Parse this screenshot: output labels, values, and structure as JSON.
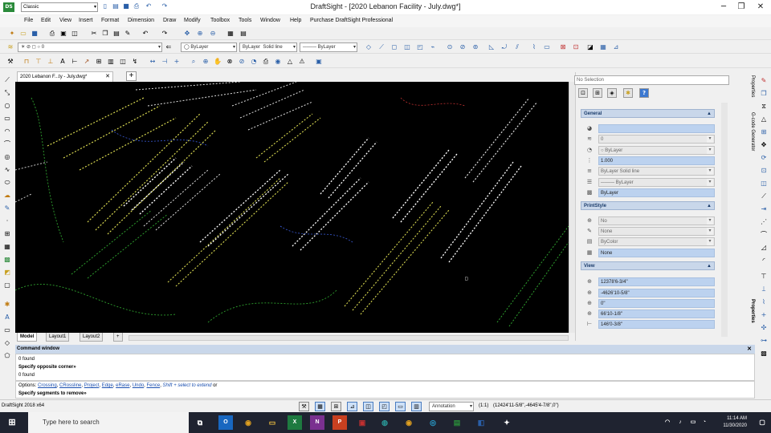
{
  "titlebar": {
    "workspace": "Classic",
    "title": "DraftSight - [2020 Lebanon Facility - July.dwg*]",
    "minimize": "─",
    "restore": "❐",
    "close": "✕"
  },
  "menubar": {
    "items": [
      "File",
      "Edit",
      "View",
      "Insert",
      "Format",
      "Dimension",
      "Draw",
      "Modify",
      "Toolbox",
      "Tools",
      "Window",
      "Help",
      "Purchase DraftSight Professional"
    ]
  },
  "layer_toolbar": {
    "layer_value": "0",
    "color_value": "ByLayer",
    "linetype_value": "ByLayer",
    "linetype_style": "Solid line",
    "lineweight_value": "ByLayer"
  },
  "doc_tab": {
    "label": "2020 Lebanon F...ty - July.dwg*",
    "close": "✕",
    "add": "+"
  },
  "layout_tabs": [
    "Model",
    "Layout1",
    "Layout2"
  ],
  "layout_add": "+",
  "properties": {
    "selection": "No Selection",
    "help_label": "?",
    "sections": {
      "general": {
        "title": "General",
        "rows": [
          "",
          "0",
          "ByLayer",
          "1.000",
          "ByLayer    Solid line",
          "──── ByLayer",
          "ByLayer"
        ]
      },
      "printstyle": {
        "title": "PrintStyle",
        "rows": [
          "No",
          "None",
          "ByColor",
          "None"
        ]
      },
      "view": {
        "title": "View",
        "rows": [
          "12378'6-3/4\"",
          "-4626'10-5/8\"",
          "0\"",
          "66'10-1/8\"",
          "146'0-3/8\""
        ]
      }
    },
    "side_tabs": [
      "Properties",
      "G-code Generator",
      "Properties"
    ]
  },
  "command": {
    "title": "Command window",
    "lines": [
      "0 found",
      "Specify opposite corner»",
      "0 found"
    ],
    "options_prefix": "Options: ",
    "options": [
      "Crossing",
      "CRossline",
      "Project",
      "Edge",
      "eRase",
      "Undo",
      "Fence"
    ],
    "options_suffix_italic": "Shift + select to extend",
    "options_or": " or",
    "prompt": "Specify segments to remove»"
  },
  "statusbar": {
    "product": "DraftSight 2018 x64",
    "annotation": "Annotation",
    "scale": "(1:1)",
    "coords": "(12424'11-5/8\",-4645'4-7/8\",0\")"
  },
  "taskbar": {
    "search_placeholder": "Type here to search",
    "time": "11:14 AM",
    "date": "11/30/2020"
  },
  "colors": {
    "canvas_bg": "#000000",
    "section_header": "#c9d7ea",
    "value_field": "#bcd2ef",
    "taskbar": "#1f2330"
  }
}
